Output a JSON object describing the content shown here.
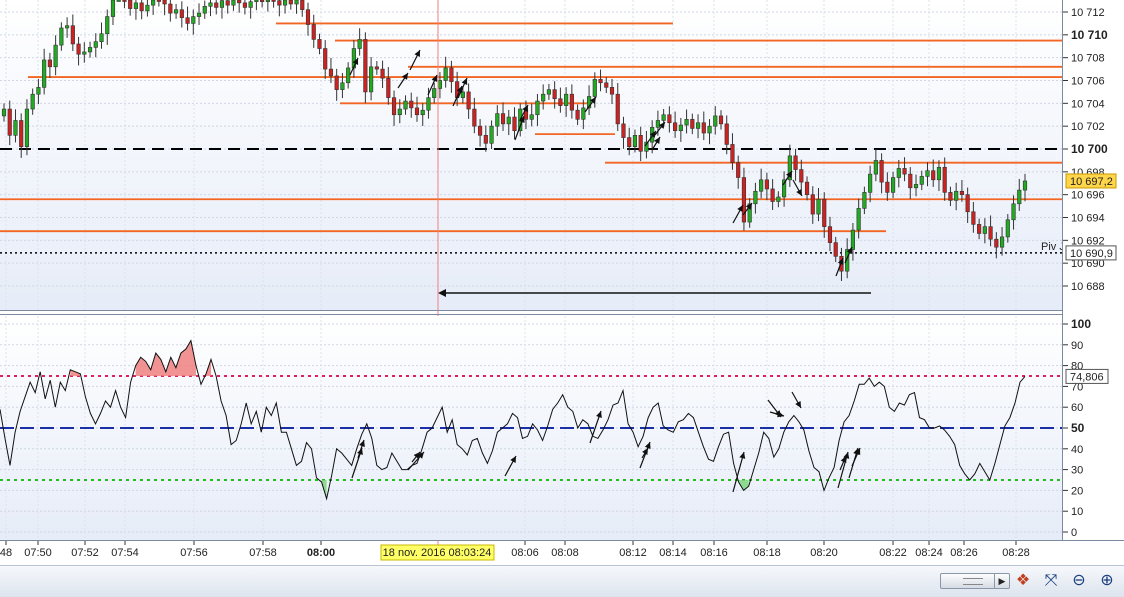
{
  "chart_data": [
    {
      "type": "candlestick",
      "title": "",
      "ylim": [
        10686.5,
        10713.5
      ],
      "y_ticks": [
        10688,
        10690,
        10692,
        10694,
        10696,
        10698,
        10700,
        10702,
        10704,
        10706,
        10708,
        10710,
        10712
      ],
      "y_tick_labels": [
        "10 688",
        "10 690",
        "10 692",
        "10 694",
        "10 696",
        "10 698",
        "10 700",
        "10 702",
        "10 704",
        "10 706",
        "10 708",
        "10 710",
        "10 712"
      ],
      "y_bold_ticks": [
        10700,
        10710
      ],
      "last_price_label": "10 697,2",
      "last_price": 10697.2,
      "pivot_label": "Piv J",
      "pivot_value_label": "10 690,9",
      "pivot_value": 10690.9,
      "crosshair_time": "08:03:24",
      "horizontal_levels": [
        {
          "value": 10700,
          "style": "black-dashed"
        },
        {
          "value": 10690.9,
          "style": "black-dotted"
        },
        {
          "value": 10711,
          "style": "orange"
        },
        {
          "value": 10709.5,
          "style": "orange"
        },
        {
          "value": 10707.2,
          "style": "orange"
        },
        {
          "value": 10706.3,
          "style": "orange"
        },
        {
          "value": 10704,
          "style": "orange"
        },
        {
          "value": 10701.3,
          "style": "orange"
        },
        {
          "value": 10698.8,
          "style": "orange"
        },
        {
          "value": 10695.6,
          "style": "orange"
        },
        {
          "value": 10692.8,
          "style": "orange"
        }
      ],
      "ohlc_close": [
        10703.5,
        10701.2,
        10702.5,
        10700.2,
        10703.5,
        10704.8,
        10705.4,
        10707.8,
        10707.2,
        10709.1,
        10710.6,
        10710.8,
        10709.2,
        10708.3,
        10708.5,
        10708.9,
        10709.4,
        10710.1,
        10711.6,
        10713.5,
        10713.8,
        10713.2,
        10712.3,
        10712.8,
        10712.1,
        10712.6,
        10713.4,
        10713.1,
        10712.7,
        10711.9,
        10712.2,
        10711.5,
        10711.0,
        10711.6,
        10711.9,
        10712.5,
        10712.8,
        10712.4,
        10713.0,
        10712.6,
        10713.2,
        10712.8,
        10712.4,
        10712.9,
        10713.6,
        10712.9,
        10713.7,
        10713.0,
        10712.6,
        10713.3,
        10712.7,
        10713.6,
        10712.2,
        10710.9,
        10709.6,
        10708.8,
        10707.0,
        10706.4,
        10705.2,
        10705.8,
        10707.1,
        10708.8,
        10709.6,
        10705.0,
        10707.2,
        10707.0,
        10706.2,
        10704.5,
        10703.0,
        10703.5,
        10704.2,
        10703.6,
        10703.0,
        10703.4,
        10704.5,
        10705.3,
        10706.0,
        10707.1,
        10705.9,
        10704.5,
        10705.0,
        10703.5,
        10702.0,
        10701.2,
        10700.5,
        10702.0,
        10703.1,
        10702.2,
        10702.8,
        10701.6,
        10703.5,
        10702.6,
        10703.0,
        10704.2,
        10704.8,
        10705.2,
        10704.4,
        10703.8,
        10704.8,
        10703.4,
        10702.6,
        10703.6,
        10704.6,
        10706.1,
        10705.8,
        10705.4,
        10704.8,
        10702.2,
        10701.0,
        10700.2,
        10701.2,
        10699.8,
        10700.6,
        10701.9,
        10702.5,
        10703.0,
        10702.3,
        10701.6,
        10702.1,
        10702.6,
        10701.8,
        10702.3,
        10701.4,
        10702.0,
        10702.9,
        10702.2,
        10700.4,
        10698.8,
        10697.5,
        10693.6,
        10695.2,
        10696.3,
        10697.3,
        10696.5,
        10695.4,
        10695.8,
        10697.3,
        10699.4,
        10698.2,
        10697.1,
        10696.0,
        10694.3,
        10695.6,
        10693.2,
        10691.8,
        10690.6,
        10689.3,
        10691.2,
        10692.9,
        10694.8,
        10696.2,
        10697.8,
        10699.0,
        10697.1,
        10696.2,
        10697.5,
        10698.3,
        10697.8,
        10696.6,
        10696.9,
        10697.6,
        10698.1,
        10697.3,
        10698.4,
        10696.2,
        10695.5,
        10696.3,
        10696.0,
        10694.5,
        10693.4,
        10692.6,
        10693.2,
        10692.1,
        10691.4,
        10692.3,
        10693.8,
        10695.2,
        10696.4,
        10697.2
      ],
      "signal_arrows": 18
    },
    {
      "type": "line",
      "title": "",
      "ylim": [
        -4,
        104
      ],
      "y_ticks": [
        0,
        10,
        20,
        30,
        40,
        50,
        60,
        70,
        80,
        90,
        100
      ],
      "y_tick_labels": [
        "0",
        "10",
        "20",
        "30",
        "40",
        "50",
        "60",
        "70",
        "80",
        "90",
        "100"
      ],
      "y_bold_ticks": [
        50,
        100
      ],
      "last_value_label": "74,806",
      "last_value": 74.8,
      "levels": [
        {
          "value": 75,
          "style": "red-dotted"
        },
        {
          "value": 50,
          "style": "blue-dashed"
        },
        {
          "value": 25,
          "style": "green-dotted"
        }
      ],
      "values": [
        59,
        45,
        32,
        48,
        58,
        65,
        72,
        67,
        77,
        64,
        73,
        60,
        72,
        68,
        78,
        77,
        76,
        65,
        57,
        52,
        57,
        63,
        60,
        68,
        60,
        55,
        72,
        80,
        84,
        82,
        78,
        86,
        83,
        77,
        84,
        79,
        86,
        88,
        92,
        80,
        71,
        76,
        83,
        75,
        63,
        56,
        42,
        44,
        52,
        62,
        52,
        58,
        48,
        60,
        56,
        62,
        48,
        48,
        40,
        32,
        34,
        43,
        40,
        26,
        24,
        16,
        27,
        40,
        38,
        35,
        32,
        40,
        47,
        52,
        45,
        32,
        30,
        31,
        38,
        34,
        30,
        30,
        32,
        33,
        40,
        48,
        50,
        55,
        60,
        48,
        54,
        42,
        40,
        37,
        44,
        45,
        38,
        33,
        39,
        48,
        50,
        52,
        57,
        55,
        45,
        46,
        52,
        49,
        44,
        51,
        59,
        62,
        66,
        60,
        58,
        50,
        54,
        52,
        46,
        45,
        49,
        54,
        61,
        62,
        68,
        52,
        48,
        41,
        46,
        55,
        60,
        62,
        51,
        49,
        48,
        53,
        54,
        57,
        55,
        48,
        41,
        35,
        34,
        41,
        47,
        48,
        33,
        24,
        20,
        22,
        30,
        38,
        48,
        45,
        36,
        40,
        48,
        53,
        56,
        53,
        49,
        39,
        31,
        29,
        20,
        26,
        31,
        44,
        53,
        56,
        63,
        71,
        71,
        74,
        70,
        72,
        70,
        60,
        58,
        62,
        61,
        66,
        67,
        55,
        54,
        50,
        50,
        51,
        49,
        46,
        42,
        32,
        28,
        25,
        28,
        33,
        29,
        25,
        33,
        42,
        51,
        55,
        62,
        72,
        74.8
      ],
      "signal_arrows": 16
    }
  ],
  "x_axis": {
    "tick_labels": [
      "48",
      "07:50",
      "07:52",
      "07:54",
      "07:56",
      "07:58",
      "08:00",
      "08:06",
      "08:08",
      "08:12",
      "08:14",
      "08:16",
      "08:18",
      "08:20",
      "08:22",
      "08:24",
      "08:26",
      "08:28"
    ],
    "bold_labels": [
      "08:00"
    ],
    "cursor_label": "18 nov. 2016 08:03:24"
  },
  "colors": {
    "up_candle": "#22aa22",
    "down_candle": "#cc2222",
    "resistance": "#f26522",
    "rsi_line": "#111111",
    "overbought_fill": "#f08080",
    "oversold_fill": "#7cd67c",
    "cursor": "#f08080",
    "label_bg": "#ffff66"
  },
  "toolbar": {
    "icons": [
      "scroll-left-icon",
      "scroll-right-icon",
      "layers-icon",
      "zoom-fit-icon",
      "zoom-out-icon",
      "zoom-in-icon"
    ]
  }
}
